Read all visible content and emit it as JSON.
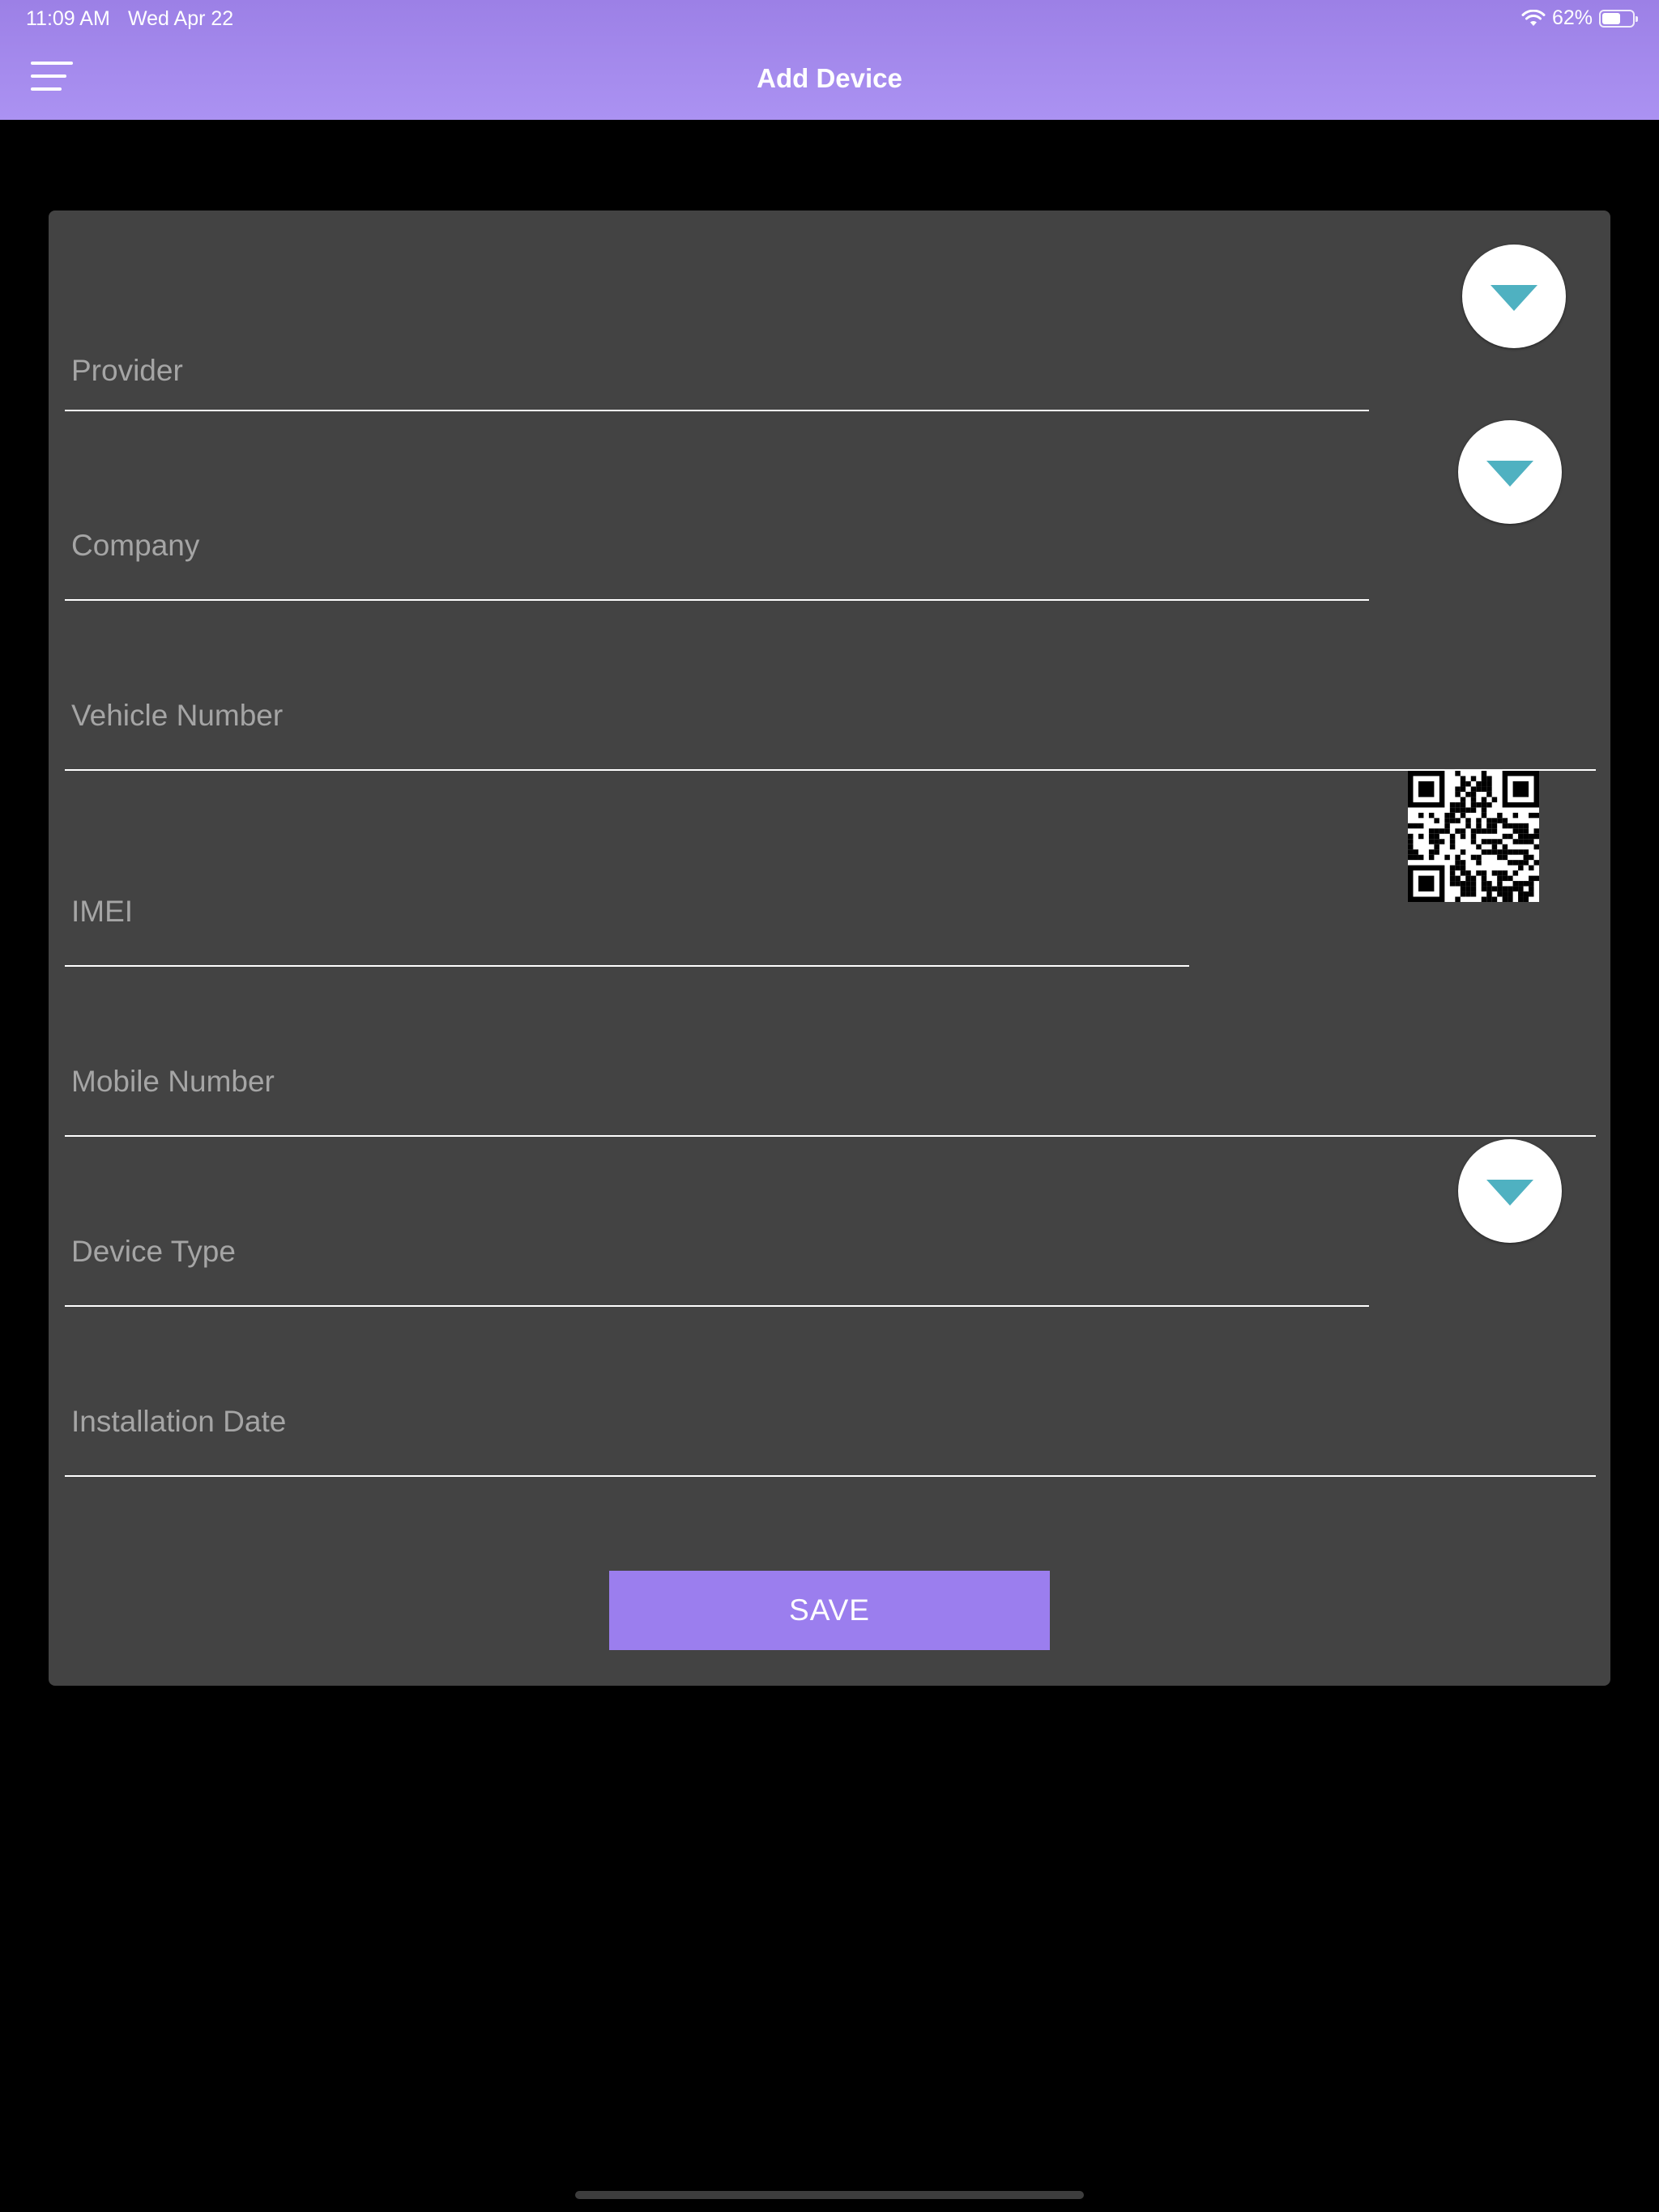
{
  "status_bar": {
    "time": "11:09 AM",
    "date": "Wed Apr 22",
    "battery_text": "62%",
    "battery_level": 0.62
  },
  "header": {
    "title": "Add Device",
    "menu_icon": "hamburger-menu-icon",
    "color": "#a58cf0"
  },
  "form": {
    "provider": {
      "placeholder": "Provider",
      "value": ""
    },
    "company": {
      "placeholder": "Company",
      "value": ""
    },
    "vehicle_number": {
      "placeholder": "Vehicle Number",
      "value": ""
    },
    "imei": {
      "placeholder": "IMEI",
      "value": ""
    },
    "mobile_number": {
      "placeholder": "Mobile Number",
      "value": ""
    },
    "device_type": {
      "placeholder": "Device Type",
      "value": ""
    },
    "installation_date": {
      "placeholder": "Installation Date",
      "value": ""
    },
    "dropdown_icon": "caret-down-icon",
    "qr_icon": "qr-code-icon",
    "card_color": "#434343",
    "caret_color": "#4fb1c1"
  },
  "actions": {
    "save_label": "SAVE",
    "save_color": "#9b7eee"
  }
}
